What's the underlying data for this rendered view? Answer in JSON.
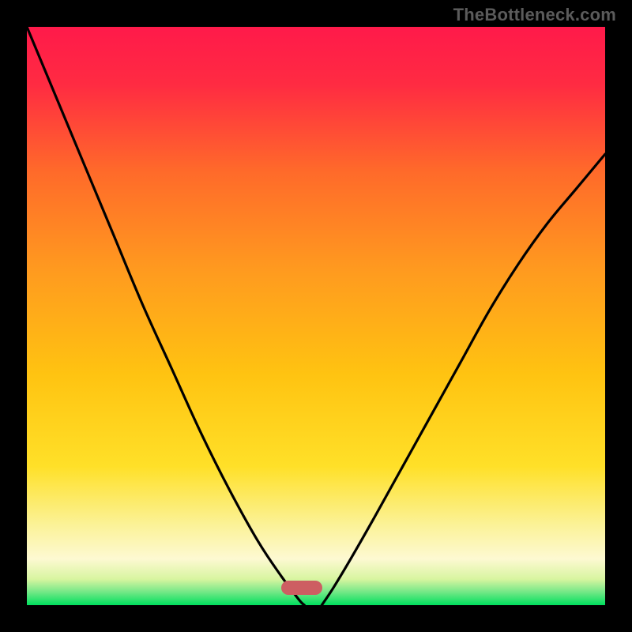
{
  "watermark": "TheBottleneck.com",
  "marker": {
    "x_pct": 47.5,
    "y_pct": 97.0
  },
  "chart_data": {
    "type": "line",
    "title": "",
    "xlabel": "",
    "ylabel": "",
    "xlim": [
      0,
      100
    ],
    "ylim": [
      0,
      100
    ],
    "grid": false,
    "legend": false,
    "colors": {
      "gradient_top": "#ff1a4a",
      "gradient_mid": "#ffd400",
      "gradient_low": "#fdf7c8",
      "gradient_bottom": "#00e060",
      "curve": "#000000",
      "marker": "#cd5e62"
    },
    "series": [
      {
        "name": "left-curve",
        "x": [
          0,
          5,
          10,
          15,
          20,
          25,
          30,
          35,
          40,
          44,
          47,
          48
        ],
        "y": [
          100,
          88,
          76,
          64,
          52,
          41,
          30,
          20,
          11,
          5,
          1,
          0
        ]
      },
      {
        "name": "right-curve",
        "x": [
          51,
          53,
          56,
          60,
          65,
          70,
          75,
          80,
          85,
          90,
          95,
          100
        ],
        "y": [
          0,
          3,
          8,
          15,
          24,
          33,
          42,
          51,
          59,
          66,
          72,
          78
        ]
      }
    ],
    "gradient_stops": [
      {
        "offset": 0.0,
        "color": "#ff1a4a"
      },
      {
        "offset": 0.1,
        "color": "#ff2b42"
      },
      {
        "offset": 0.25,
        "color": "#ff6a2a"
      },
      {
        "offset": 0.42,
        "color": "#ff9a1f"
      },
      {
        "offset": 0.6,
        "color": "#ffc311"
      },
      {
        "offset": 0.76,
        "color": "#ffe028"
      },
      {
        "offset": 0.86,
        "color": "#fbf296"
      },
      {
        "offset": 0.92,
        "color": "#fdf9d2"
      },
      {
        "offset": 0.955,
        "color": "#d8f5a0"
      },
      {
        "offset": 0.975,
        "color": "#7ee98a"
      },
      {
        "offset": 1.0,
        "color": "#00df5e"
      }
    ]
  }
}
